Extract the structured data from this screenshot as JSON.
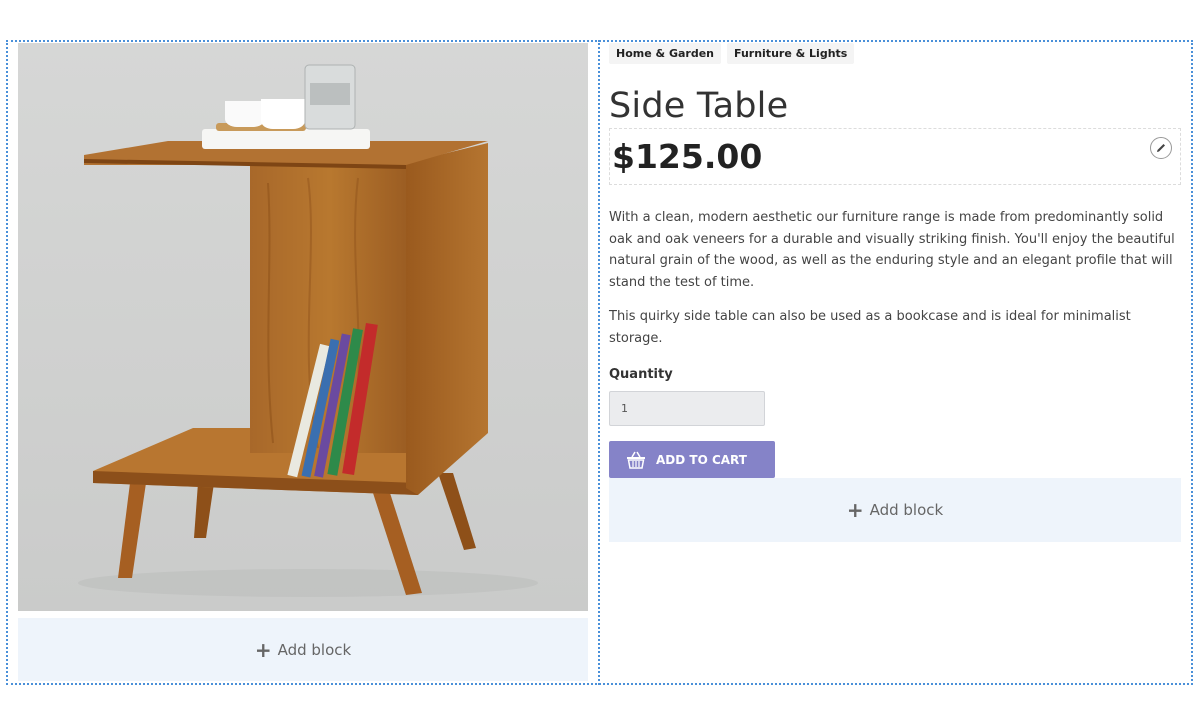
{
  "breadcrumb": {
    "items": [
      "Home & Garden",
      "Furniture & Lights"
    ]
  },
  "product": {
    "title": "Side Table",
    "price": "$125.00",
    "description": [
      "With a clean, modern aesthetic our furniture range is made from predominantly solid oak and oak veneers for a durable and visually striking finish. You'll enjoy the beautiful natural grain of the wood, as well as the enduring style and an elegant profile that will stand the test of time.",
      "This quirky side table can also be used as a bookcase and is ideal for minimalist storage."
    ],
    "quantity_label": "Quantity",
    "quantity_value": "1",
    "add_to_cart_label": "ADD TO CART"
  },
  "blocks": {
    "add_block_label": "Add block"
  },
  "icons": {
    "edit": "pencil-icon",
    "cart": "basket-icon",
    "add": "plus-icon"
  },
  "colors": {
    "accent": "#8583c8",
    "frame": "#4a90d9",
    "add_block_bg": "#eef4fb"
  }
}
